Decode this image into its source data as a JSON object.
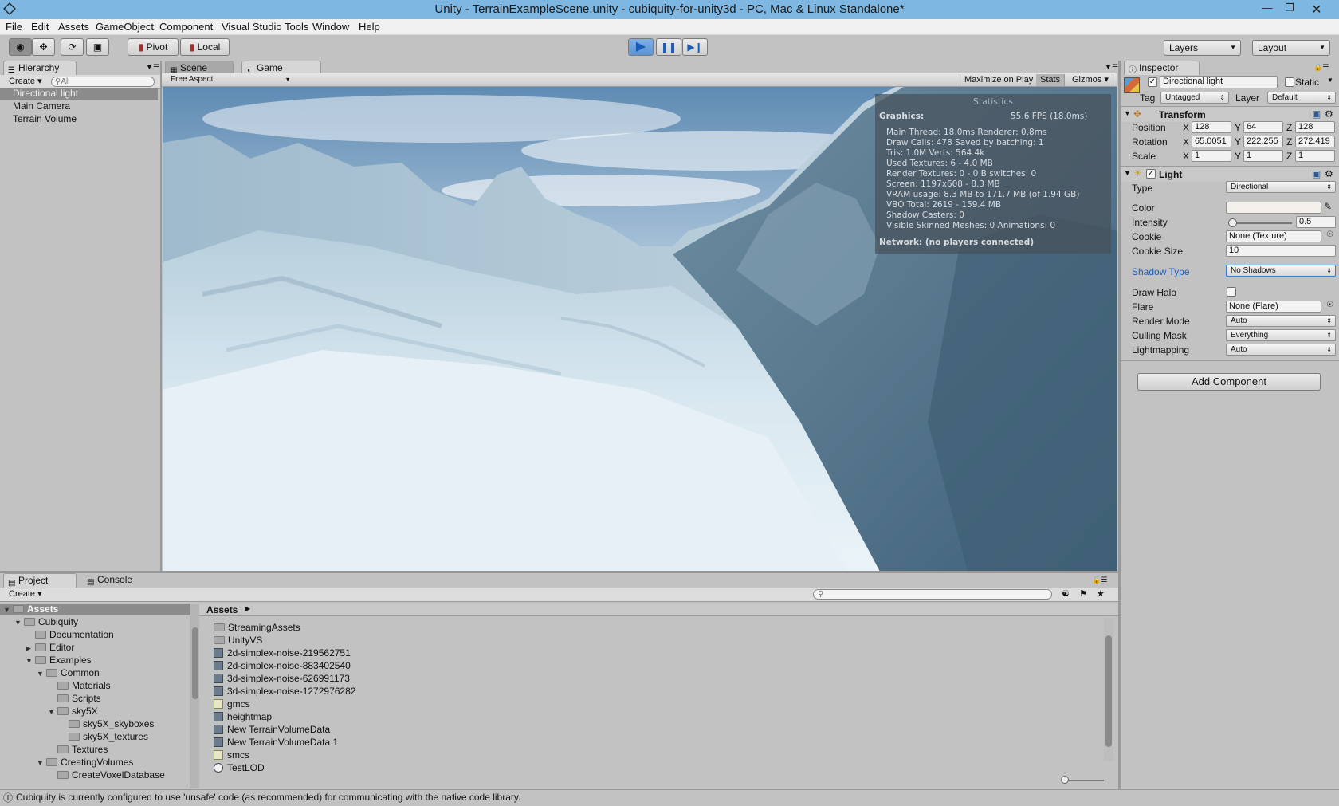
{
  "window": {
    "title": "Unity - TerrainExampleScene.unity - cubiquity-for-unity3d - PC, Mac & Linux Standalone*"
  },
  "menu": [
    "File",
    "Edit",
    "Assets",
    "GameObject",
    "Component",
    "Visual Studio Tools",
    "Window",
    "Help"
  ],
  "toolbar": {
    "pivot": "Pivot",
    "local": "Local",
    "layers": "Layers",
    "layout": "Layout"
  },
  "hierarchy": {
    "tab": "Hierarchy",
    "create": "Create",
    "search_placeholder": "All",
    "items": [
      "Directional light",
      "Main Camera",
      "Terrain Volume"
    ]
  },
  "scene_tabs": {
    "scene": "Scene",
    "game": "Game"
  },
  "game_bar": {
    "aspect": "Free Aspect",
    "maximize": "Maximize on Play",
    "stats": "Stats",
    "gizmos": "Gizmos"
  },
  "stats": {
    "title": "Statistics",
    "graphics": "Graphics:",
    "fps": "55.6 FPS (18.0ms)",
    "lines": [
      "Main Thread: 18.0ms  Renderer: 0.8ms",
      "Draw Calls: 478   Saved by batching: 1",
      "Tris: 1.0M   Verts: 564.4k",
      "Used Textures: 6 - 4.0 MB",
      "Render Textures: 0 - 0 B  switches: 0",
      "Screen: 1197x608 - 8.3 MB",
      "VRAM usage: 8.3 MB to 171.7 MB (of 1.94 GB)",
      "VBO Total: 2619 - 159.4 MB",
      "Shadow Casters: 0",
      "Visible Skinned Meshes: 0     Animations: 0"
    ],
    "network": "Network: (no players connected)"
  },
  "inspector": {
    "tab": "Inspector",
    "object_name": "Directional light",
    "static": "Static",
    "tag_label": "Tag",
    "tag": "Untagged",
    "layer_label": "Layer",
    "layer": "Default",
    "transform": {
      "title": "Transform",
      "position": {
        "label": "Position",
        "x": "128",
        "y": "64",
        "z": "128"
      },
      "rotation": {
        "label": "Rotation",
        "x": "65.0051",
        "y": "222.255",
        "z": "272.419"
      },
      "scale": {
        "label": "Scale",
        "x": "1",
        "y": "1",
        "z": "1"
      }
    },
    "light": {
      "title": "Light",
      "type_label": "Type",
      "type": "Directional",
      "color_label": "Color",
      "intensity_label": "Intensity",
      "intensity": "0.5",
      "cookie_label": "Cookie",
      "cookie": "None (Texture)",
      "cookie_size_label": "Cookie Size",
      "cookie_size": "10",
      "shadow_type_label": "Shadow Type",
      "shadow_type": "No Shadows",
      "draw_halo_label": "Draw Halo",
      "flare_label": "Flare",
      "flare": "None (Flare)",
      "render_mode_label": "Render Mode",
      "render_mode": "Auto",
      "culling_mask_label": "Culling Mask",
      "culling_mask": "Everything",
      "lightmapping_label": "Lightmapping",
      "lightmapping": "Auto"
    },
    "add_component": "Add Component"
  },
  "project": {
    "tabs": {
      "project": "Project",
      "console": "Console"
    },
    "create": "Create",
    "tree": [
      {
        "label": "Assets",
        "depth": 0,
        "exp": "open"
      },
      {
        "label": "Cubiquity",
        "depth": 1,
        "exp": "open"
      },
      {
        "label": "Documentation",
        "depth": 2,
        "exp": ""
      },
      {
        "label": "Editor",
        "depth": 2,
        "exp": "closed"
      },
      {
        "label": "Examples",
        "depth": 2,
        "exp": "open"
      },
      {
        "label": "Common",
        "depth": 3,
        "exp": "open"
      },
      {
        "label": "Materials",
        "depth": 4,
        "exp": ""
      },
      {
        "label": "Scripts",
        "depth": 4,
        "exp": ""
      },
      {
        "label": "sky5X",
        "depth": 4,
        "exp": "open"
      },
      {
        "label": "sky5X_skyboxes",
        "depth": 5,
        "exp": ""
      },
      {
        "label": "sky5X_textures",
        "depth": 5,
        "exp": ""
      },
      {
        "label": "Textures",
        "depth": 4,
        "exp": ""
      },
      {
        "label": "CreatingVolumes",
        "depth": 3,
        "exp": "open"
      },
      {
        "label": "CreateVoxelDatabase",
        "depth": 4,
        "exp": ""
      }
    ],
    "breadcrumb": "Assets",
    "files": [
      {
        "name": "StreamingAssets",
        "kind": "folder"
      },
      {
        "name": "UnityVS",
        "kind": "folder"
      },
      {
        "name": "2d-simplex-noise-219562751",
        "kind": "asset"
      },
      {
        "name": "2d-simplex-noise-883402540",
        "kind": "asset"
      },
      {
        "name": "3d-simplex-noise-626991173",
        "kind": "asset"
      },
      {
        "name": "3d-simplex-noise-1272976282",
        "kind": "asset"
      },
      {
        "name": "gmcs",
        "kind": "text"
      },
      {
        "name": "heightmap",
        "kind": "asset"
      },
      {
        "name": "New TerrainVolumeData",
        "kind": "asset"
      },
      {
        "name": "New TerrainVolumeData 1",
        "kind": "asset"
      },
      {
        "name": "smcs",
        "kind": "text"
      },
      {
        "name": "TestLOD",
        "kind": "script"
      }
    ]
  },
  "status": "Cubiquity is currently configured to use 'unsafe' code (as recommended) for communicating with the native code library."
}
